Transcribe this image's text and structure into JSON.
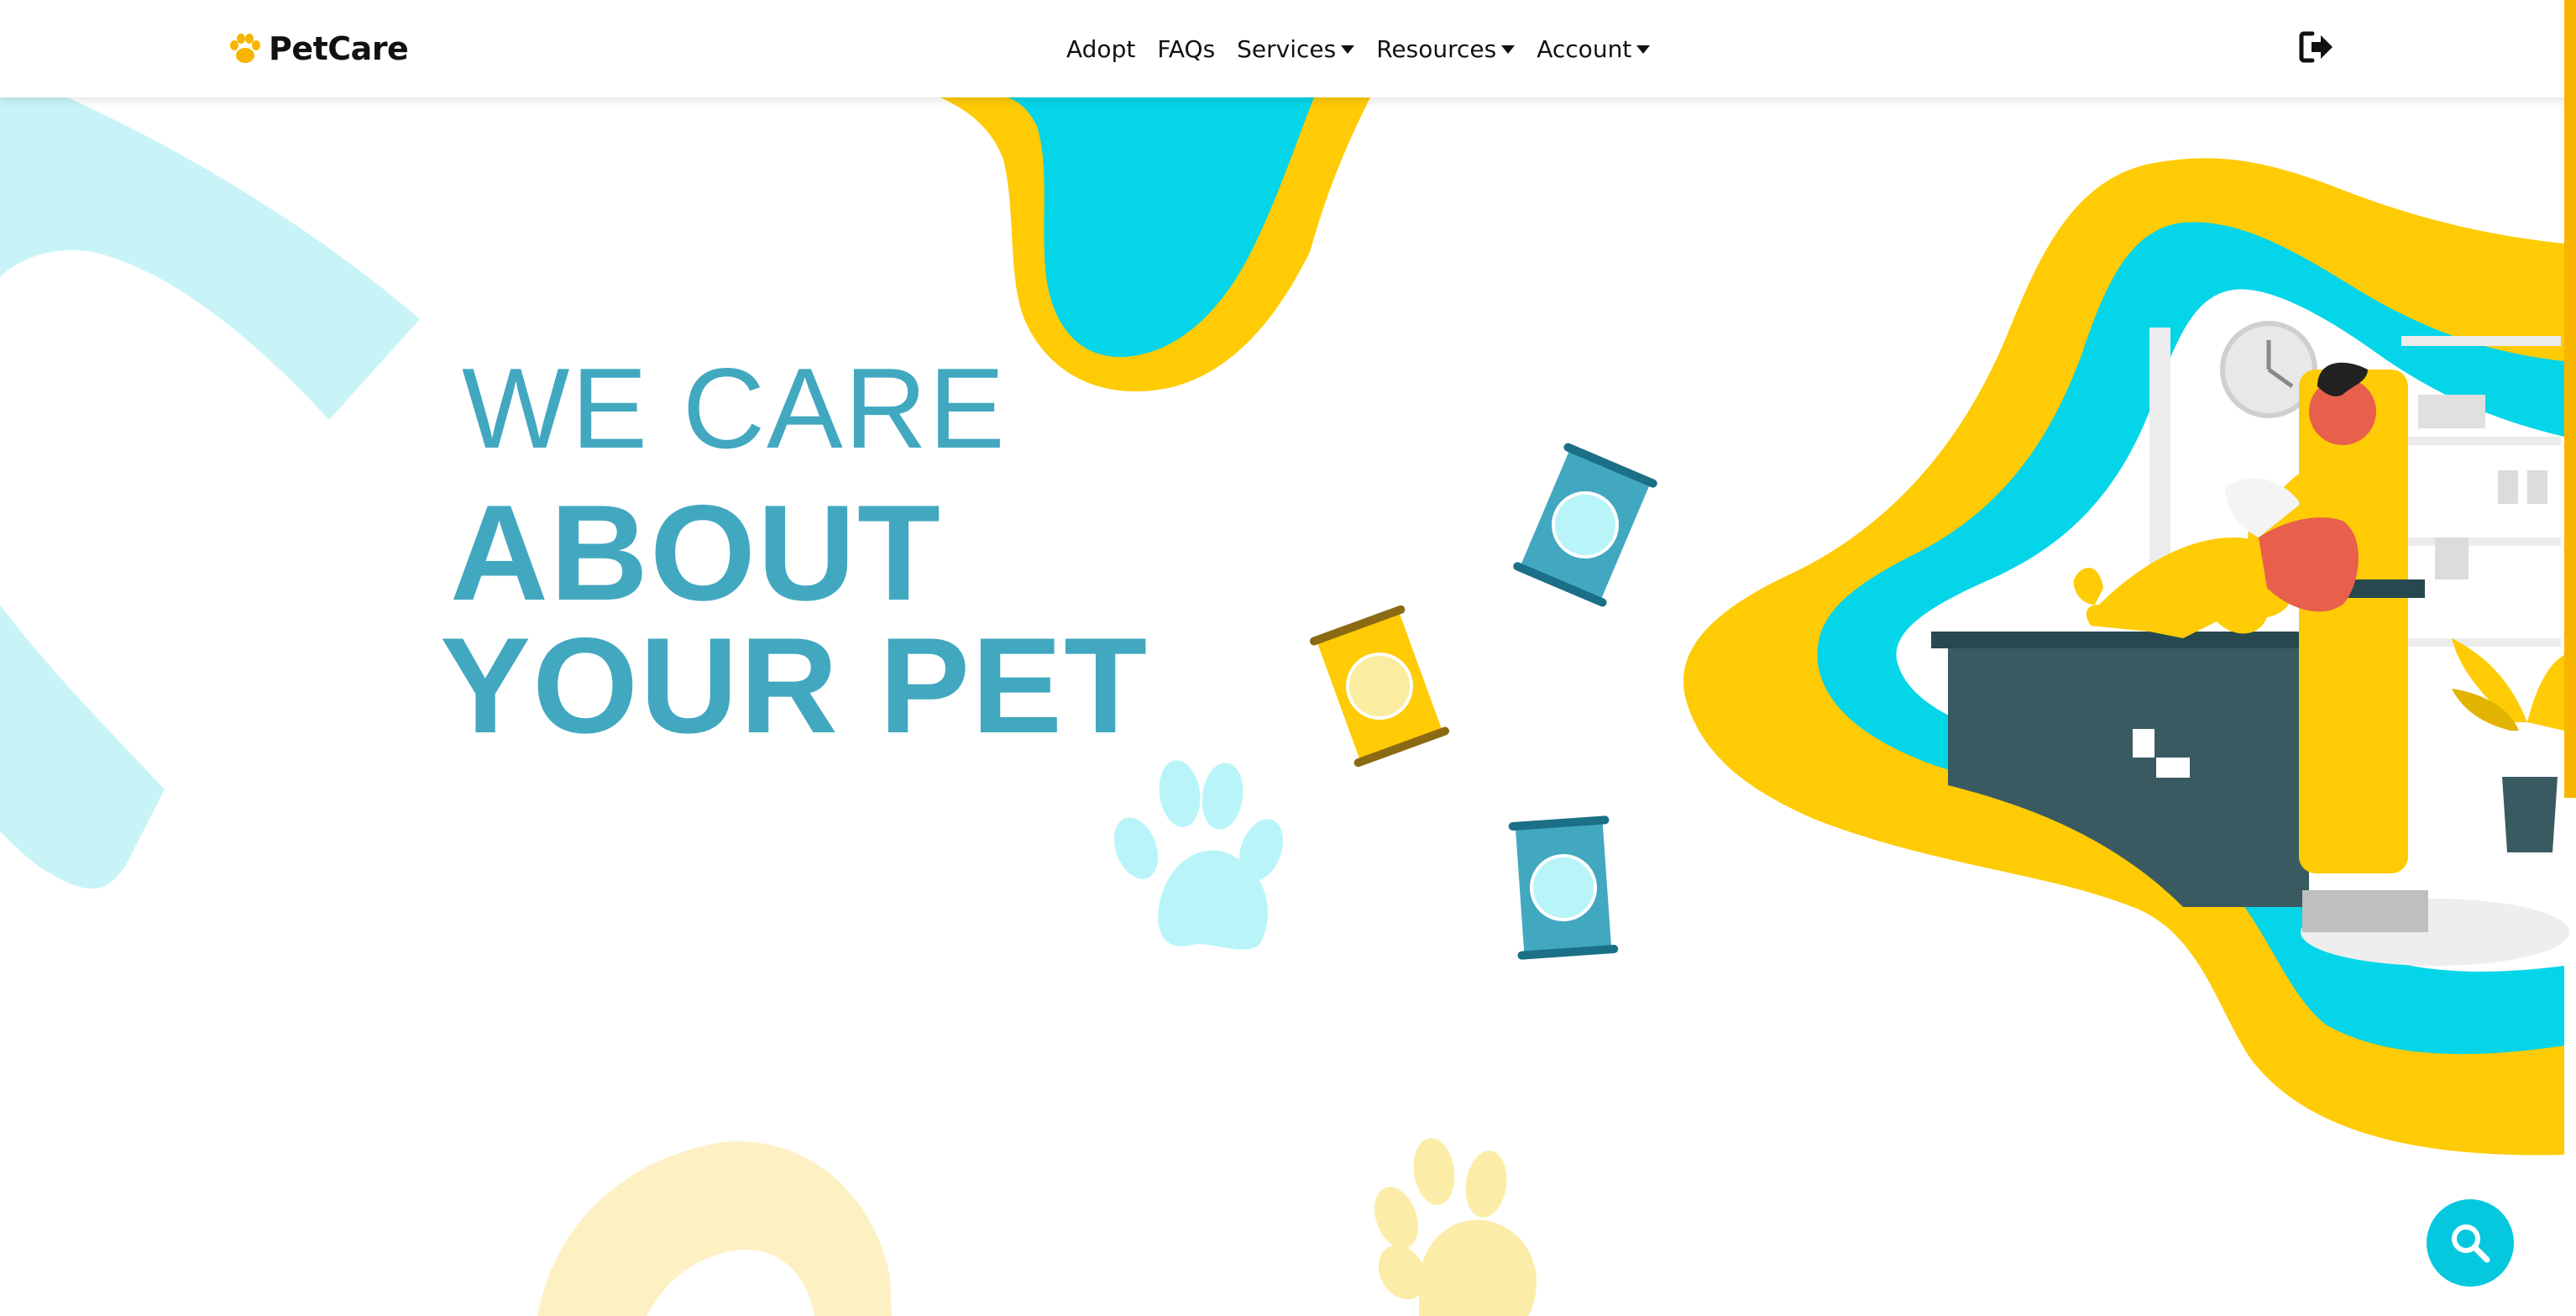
{
  "brand": {
    "name": "PetCare",
    "icon": "paw-icon",
    "icon_color": "#f7b500"
  },
  "nav": {
    "items": [
      {
        "label": "Adopt",
        "dropdown": false
      },
      {
        "label": "FAQs",
        "dropdown": false
      },
      {
        "label": "Services",
        "dropdown": true
      },
      {
        "label": "Resources",
        "dropdown": true
      },
      {
        "label": "Account",
        "dropdown": true
      }
    ],
    "logout_icon": "sign-out-icon"
  },
  "hero": {
    "line1": "WE CARE",
    "line2": "ABOUT",
    "line3": "YOUR PET"
  },
  "colors": {
    "accent_teal": "#42a8c0",
    "cyan": "#05d5e8",
    "yellow": "#fecb05",
    "light_cyan": "#c8f4f8",
    "light_yellow": "#fdf1c4"
  },
  "search_button_icon": "search-icon"
}
